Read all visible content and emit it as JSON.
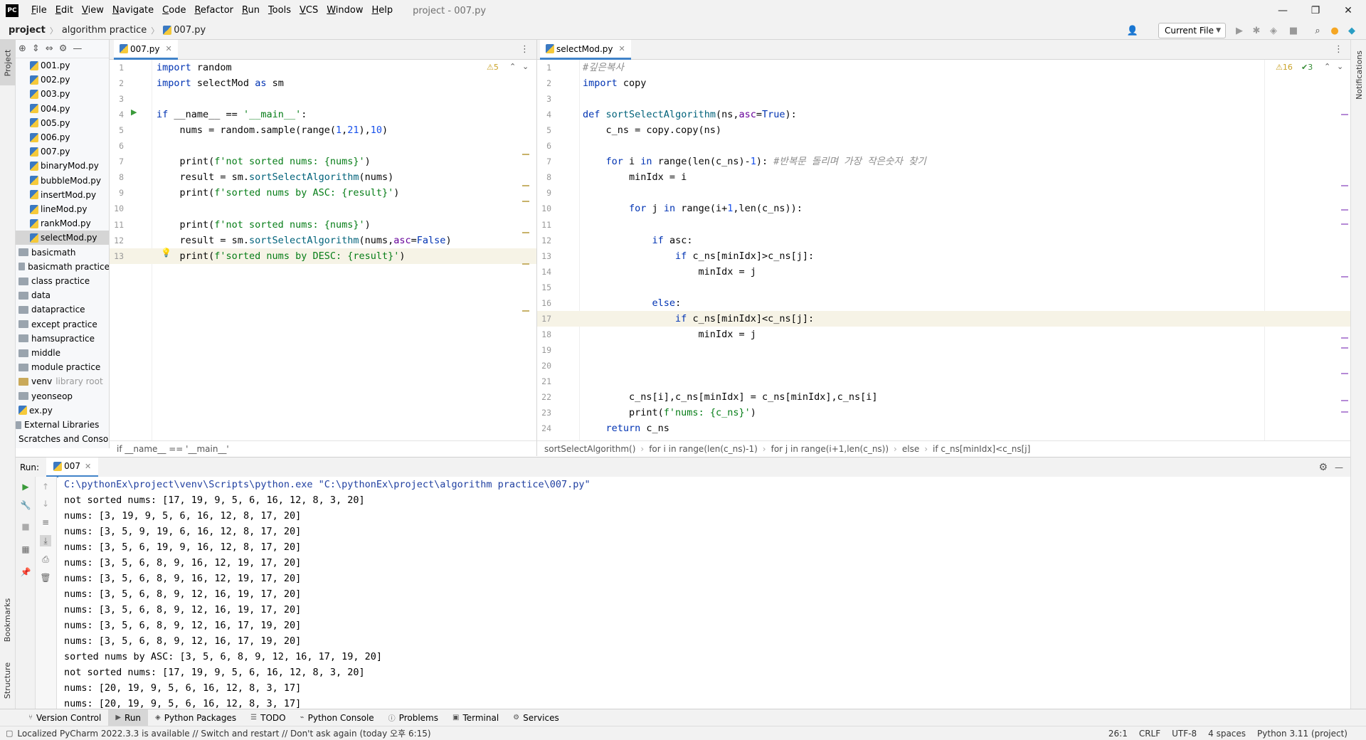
{
  "app": {
    "logo_text": "PC",
    "window_title": "project - 007.py"
  },
  "menu": [
    "File",
    "Edit",
    "View",
    "Navigate",
    "Code",
    "Refactor",
    "Run",
    "Tools",
    "VCS",
    "Window",
    "Help"
  ],
  "window_controls": {
    "minimize": "—",
    "maximize": "❐",
    "close": "✕"
  },
  "breadcrumb": [
    "project",
    "algorithm practice",
    "007.py"
  ],
  "run_config": "Current File",
  "side_tabs": {
    "project": "Project",
    "bookmarks": "Bookmarks",
    "structure": "Structure",
    "notifications": "Notifications"
  },
  "project_tree": [
    {
      "label": "001.py",
      "type": "py"
    },
    {
      "label": "002.py",
      "type": "py"
    },
    {
      "label": "003.py",
      "type": "py"
    },
    {
      "label": "004.py",
      "type": "py"
    },
    {
      "label": "005.py",
      "type": "py"
    },
    {
      "label": "006.py",
      "type": "py"
    },
    {
      "label": "007.py",
      "type": "py"
    },
    {
      "label": "binaryMod.py",
      "type": "py"
    },
    {
      "label": "bubbleMod.py",
      "type": "py"
    },
    {
      "label": "insertMod.py",
      "type": "py"
    },
    {
      "label": "lineMod.py",
      "type": "py"
    },
    {
      "label": "rankMod.py",
      "type": "py"
    },
    {
      "label": "selectMod.py",
      "type": "py",
      "selected": true
    },
    {
      "label": "basicmath",
      "type": "folder"
    },
    {
      "label": "basicmath practice",
      "type": "folder"
    },
    {
      "label": "class practice",
      "type": "folder"
    },
    {
      "label": "data",
      "type": "folder"
    },
    {
      "label": "datapractice",
      "type": "folder"
    },
    {
      "label": "except practice",
      "type": "folder"
    },
    {
      "label": "hamsupractice",
      "type": "folder"
    },
    {
      "label": "middle",
      "type": "folder"
    },
    {
      "label": "module practice",
      "type": "folder"
    },
    {
      "label": "venv",
      "type": "folder",
      "suffix": "library root"
    },
    {
      "label": "yeonseop",
      "type": "folder"
    },
    {
      "label": "ex.py",
      "type": "py"
    },
    {
      "label": "External Libraries",
      "type": "lib"
    },
    {
      "label": "Scratches and Consoles",
      "type": "lib"
    }
  ],
  "editor_left": {
    "tab": "007.py",
    "inspection": "⚠5",
    "lines": [
      "import random",
      "import selectMod as sm",
      "",
      "if __name__ == '__main__':",
      "    nums = random.sample(range(1,21),10)",
      "",
      "    print(f'not sorted nums: {nums}')",
      "    result = sm.sortSelectAlgorithm(nums)",
      "    print(f'sorted nums by ASC: {result}')",
      "",
      "    print(f'not sorted nums: {nums}')",
      "    result = sm.sortSelectAlgorithm(nums,asc=False)",
      "    print(f'sorted nums by DESC: {result}')"
    ],
    "breadcrumb": [
      "if __name__ == '__main__'"
    ]
  },
  "editor_right": {
    "tab": "selectMod.py",
    "inspection_warn": "⚠16",
    "inspection_ok": "✔3",
    "lines": [
      "#깊은복사",
      "import copy",
      "",
      "def sortSelectAlgorithm(ns,asc=True):",
      "    c_ns = copy.copy(ns)",
      "",
      "    for i in range(len(c_ns)-1): #반복문 돌리며 가장 작은숫자 찾기",
      "        minIdx = i",
      "",
      "        for j in range(i+1,len(c_ns)):",
      "",
      "            if asc:",
      "                if c_ns[minIdx]>c_ns[j]:",
      "                    minIdx = j",
      "",
      "            else:",
      "                if c_ns[minIdx]<c_ns[j]:",
      "                    minIdx = j",
      "",
      "",
      "",
      "        c_ns[i],c_ns[minIdx] = c_ns[minIdx],c_ns[i]",
      "        print(f'nums: {c_ns}')",
      "    return c_ns"
    ],
    "breadcrumb": [
      "sortSelectAlgorithm()",
      "for i in range(len(c_ns)-1)",
      "for j in range(i+1,len(c_ns))",
      "else",
      "if c_ns[minIdx]<c_ns[j]"
    ]
  },
  "run_panel": {
    "label": "Run:",
    "tab": "007",
    "output": [
      "C:\\pythonEx\\project\\venv\\Scripts\\python.exe \"C:\\pythonEx\\project\\algorithm practice\\007.py\"",
      "not sorted nums: [17, 19, 9, 5, 6, 16, 12, 8, 3, 20]",
      "nums: [3, 19, 9, 5, 6, 16, 12, 8, 17, 20]",
      "nums: [3, 5, 9, 19, 6, 16, 12, 8, 17, 20]",
      "nums: [3, 5, 6, 19, 9, 16, 12, 8, 17, 20]",
      "nums: [3, 5, 6, 8, 9, 16, 12, 19, 17, 20]",
      "nums: [3, 5, 6, 8, 9, 16, 12, 19, 17, 20]",
      "nums: [3, 5, 6, 8, 9, 12, 16, 19, 17, 20]",
      "nums: [3, 5, 6, 8, 9, 12, 16, 19, 17, 20]",
      "nums: [3, 5, 6, 8, 9, 12, 16, 17, 19, 20]",
      "nums: [3, 5, 6, 8, 9, 12, 16, 17, 19, 20]",
      "sorted nums by ASC: [3, 5, 6, 8, 9, 12, 16, 17, 19, 20]",
      "not sorted nums: [17, 19, 9, 5, 6, 16, 12, 8, 3, 20]",
      "nums: [20, 19, 9, 5, 6, 16, 12, 8, 3, 17]",
      "nums: [20, 19, 9, 5, 6, 16, 12, 8, 3, 17]"
    ]
  },
  "bottom_tools": [
    {
      "label": "Version Control",
      "icon": "branch-icon"
    },
    {
      "label": "Run",
      "icon": "play-icon",
      "active": true
    },
    {
      "label": "Python Packages",
      "icon": "packages-icon"
    },
    {
      "label": "TODO",
      "icon": "list-icon"
    },
    {
      "label": "Python Console",
      "icon": "console-icon"
    },
    {
      "label": "Problems",
      "icon": "problems-icon"
    },
    {
      "label": "Terminal",
      "icon": "terminal-icon"
    },
    {
      "label": "Services",
      "icon": "services-icon"
    }
  ],
  "status": {
    "message": "Localized PyCharm 2022.3.3 is available // Switch and restart // Don't ask again (today 오후 6:15)",
    "position": "26:1",
    "line_sep": "CRLF",
    "encoding": "UTF-8",
    "indent": "4 spaces",
    "interpreter": "Python 3.11 (project)"
  }
}
